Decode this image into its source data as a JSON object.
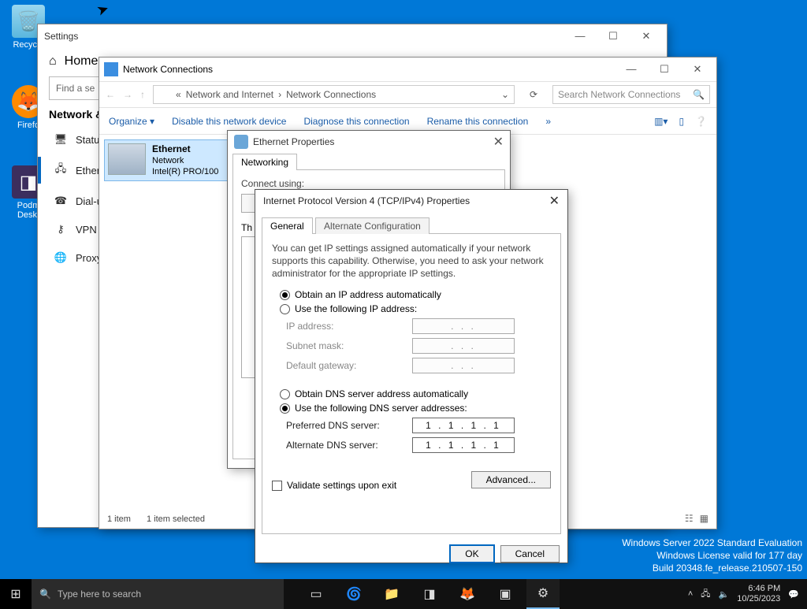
{
  "desktop": {
    "recycle": "Recycle",
    "firefox": "Firefo",
    "podman": "Podm\nDeskt"
  },
  "settings": {
    "title": "Settings",
    "home": "Home",
    "search_placeholder": "Find a se",
    "section": "Network &",
    "items": {
      "status": "Status",
      "ethernet": "Ethern",
      "dialup": "Dial-u",
      "vpn": "VPN",
      "proxy": "Proxy"
    }
  },
  "nc": {
    "title": "Network Connections",
    "breadcrumb1": "Network and Internet",
    "breadcrumb2": "Network Connections",
    "search_placeholder": "Search Network Connections",
    "cmds": {
      "organize": "Organize ▾",
      "disable": "Disable this network device",
      "diagnose": "Diagnose this connection",
      "rename": "Rename this connection",
      "more": "»"
    },
    "ethernet": {
      "name": "Ethernet",
      "status": "Network",
      "adapter": "Intel(R) PRO/100"
    },
    "status_items": "1 item",
    "status_selected": "1 item selected"
  },
  "ethprops": {
    "title": "Ethernet Properties",
    "tab": "Networking",
    "connect_label": "Connect using:",
    "items_label": "Th"
  },
  "ipv4": {
    "title": "Internet Protocol Version 4 (TCP/IPv4) Properties",
    "tabs": {
      "general": "General",
      "alt": "Alternate Configuration"
    },
    "desc": "You can get IP settings assigned automatically if your network supports this capability. Otherwise, you need to ask your network administrator for the appropriate IP settings.",
    "radio_auto_ip": "Obtain an IP address automatically",
    "radio_manual_ip": "Use the following IP address:",
    "ip_label": "IP address:",
    "mask_label": "Subnet mask:",
    "gw_label": "Default gateway:",
    "radio_auto_dns": "Obtain DNS server address automatically",
    "radio_manual_dns": "Use the following DNS server addresses:",
    "pref_dns_label": "Preferred DNS server:",
    "alt_dns_label": "Alternate DNS server:",
    "pref_dns_value": "1  .  1  .  1  .  1",
    "alt_dns_value": "1  .  1  .  1  .  1",
    "placeholder_dots": ".       .       .",
    "validate": "Validate settings upon exit",
    "advanced": "Advanced...",
    "ok": "OK",
    "cancel": "Cancel"
  },
  "watermark": {
    "l1": "Windows Server 2022 Standard Evaluation",
    "l2": "Windows License valid for 177 day",
    "l3": "Build 20348.fe_release.210507-150"
  },
  "taskbar": {
    "search": "Type here to search",
    "time": "6:46 PM",
    "date": "10/25/2023"
  }
}
